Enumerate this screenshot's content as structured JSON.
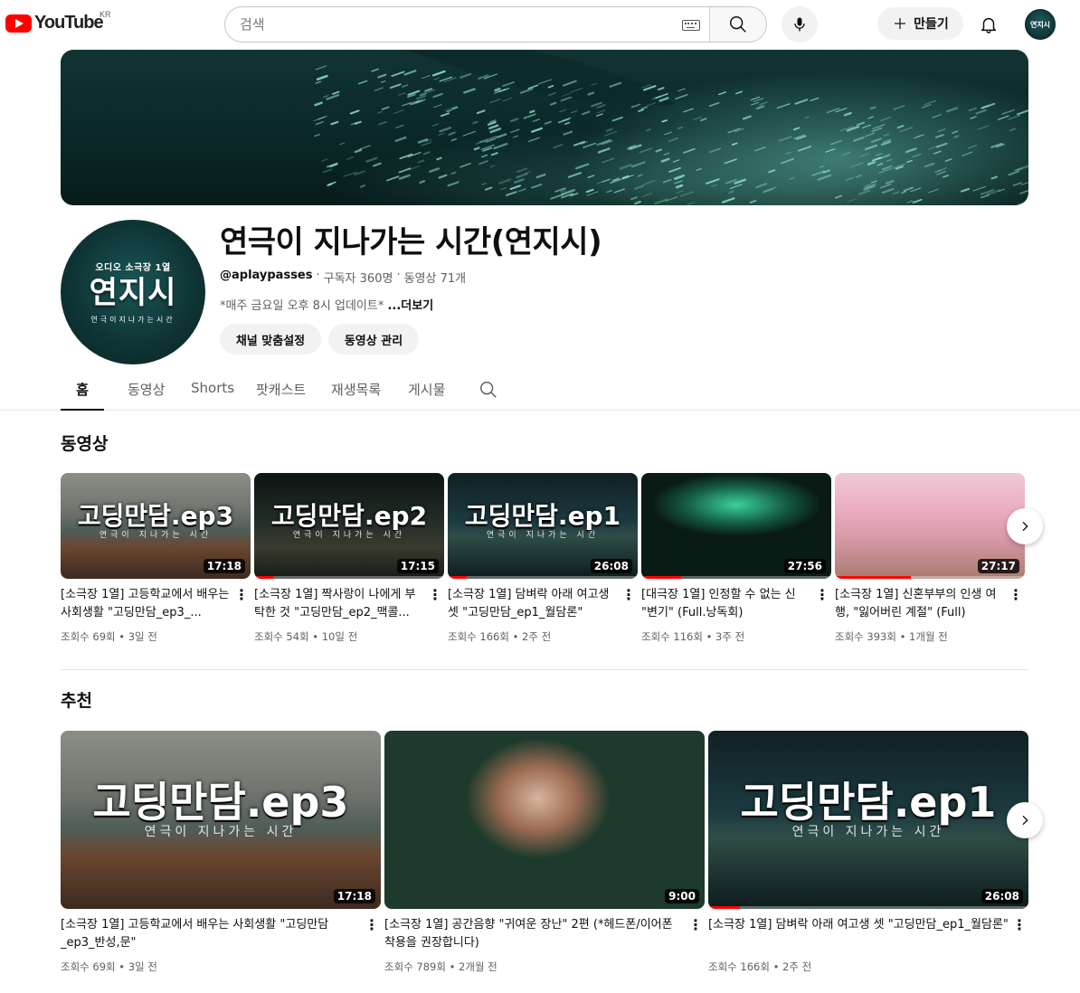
{
  "header": {
    "logo_text": "YouTube",
    "region": "KR",
    "search_placeholder": "검색",
    "create_label": "만들기",
    "avatar_text": "연지시"
  },
  "channel": {
    "avatar_sub": "오디오 소극장 1열",
    "avatar_title": "연지시",
    "avatar_line": "연극이지나가는시간",
    "name": "연극이 지나가는 시간(연지시)",
    "handle": "@aplaypasses",
    "subscribers": "구독자 360명",
    "video_count": "동영상 71개",
    "separator": "·",
    "description": "*매주 금요일 오후 8시 업데이트*",
    "more_label": "...더보기",
    "customize_button": "채널 맞춤설정",
    "manage_button": "동영상 관리"
  },
  "tabs": [
    "홈",
    "동영상",
    "Shorts",
    "팟캐스트",
    "재생목록",
    "게시물"
  ],
  "videos_section": {
    "title": "동영상",
    "items": [
      {
        "caption": "고딩만담.ep3",
        "sub": "연극이 지나가는 시간",
        "duration": "17:18",
        "progress": 0,
        "title": "[소극장 1열] 고등학교에서 배우는 사회생활 \"고딩만담_ep3_...",
        "views": "조회수 69회",
        "age": "3일 전"
      },
      {
        "caption": "고딩만담.ep2",
        "sub": "연극이 지나가는 시간",
        "duration": "17:15",
        "progress": 0.1,
        "title": "[소극장 1열] 짝사랑이 나에게 부탁한 것 \"고딩만담_ep2_맥콜...",
        "views": "조회수 54회",
        "age": "10일 전"
      },
      {
        "caption": "고딩만담.ep1",
        "sub": "연극이 지나가는 시간",
        "duration": "26:08",
        "progress": 0.1,
        "title": "[소극장 1열] 담벼락 아래 여고생 셋 \"고딩만담_ep1_월담론\"",
        "views": "조회수 166회",
        "age": "2주 전"
      },
      {
        "caption": "",
        "sub": "",
        "duration": "27:56",
        "progress": 0.21,
        "title": "[대극장 1열] 인정할 수 없는 신 \"변기\" (Full.낭독회)",
        "views": "조회수 116회",
        "age": "3주 전"
      },
      {
        "caption": "",
        "sub": "",
        "duration": "27:17",
        "progress": 0.4,
        "title": "[소극장 1열] 신혼부부의 인생 여행, \"잃어버린 계절\" (Full)",
        "views": "조회수 393회",
        "age": "1개월 전"
      }
    ]
  },
  "recommended_section": {
    "title": "추천",
    "items": [
      {
        "caption": "고딩만담.ep3",
        "sub": "연극이 지나가는 시간",
        "duration": "17:18",
        "progress": 0,
        "title": "[소극장 1열] 고등학교에서 배우는 사회생활 \"고딩만담_ep3_반성,문\"",
        "views": "조회수 69회",
        "age": "3일 전"
      },
      {
        "caption": "",
        "sub": "",
        "duration": "9:00",
        "progress": 0,
        "title": "[소극장 1열] 공간음향 \"귀여운 장난\" 2편 (*헤드폰/이어폰 착용을 권장합니다)",
        "views": "조회수 789회",
        "age": "2개월 전"
      },
      {
        "caption": "고딩만담.ep1",
        "sub": "연극이 지나가는 시간",
        "duration": "26:08",
        "progress": 0.1,
        "title": "[소극장 1열] 담벼락 아래 여고생 셋 \"고딩만담_ep1_월담론\"",
        "views": "조회수 166회",
        "age": "2주 전"
      }
    ]
  },
  "colors": {
    "accent_red": "#ff0000",
    "banner_teal": "#0f3536"
  },
  "icons": {
    "search": "search-icon",
    "mic": "mic-icon",
    "bell": "bell-icon",
    "plus": "plus-icon",
    "keyboard": "keyboard-icon",
    "chevron": "chevron-right-icon",
    "more": "more-vert-icon"
  }
}
